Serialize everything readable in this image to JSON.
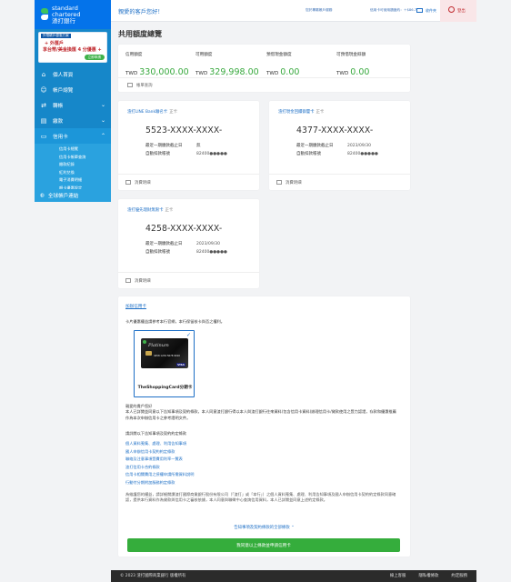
{
  "brand": {
    "line1": "standard",
    "line2": "chartered",
    "line3": "渣打銀行"
  },
  "promo": {
    "tag": "外幣帳戶優惠方案",
    "line1": "+ 外匯戶",
    "line2": "享台幣/美金換匯 4 分優惠 +",
    "button": "立即申請"
  },
  "nav": {
    "home": "個人首頁",
    "accounts": "帳戶總覽",
    "transfer": "轉帳",
    "payment": "繳款",
    "credit_card": "信用卡",
    "sub_items": [
      "信用卡總覽",
      "信用卡帳單查詢",
      "繳款紀錄",
      "紅利兌換",
      "電子消費明細",
      "額卡優惠設定"
    ],
    "global": "全球帳戶連結"
  },
  "topbar": {
    "greeting": "親愛的客戶您好！",
    "last_login": "您於專屬帳戶服務",
    "cc_balance": "信用卡可使用額度約：＋$86.7",
    "inbox": "收件夾",
    "logout": "登出"
  },
  "page_title": "共用額度總覽",
  "summary": {
    "credit_limit": {
      "label": "信用額度",
      "currency": "TWD",
      "value": "330,000.00"
    },
    "available": {
      "label": "可用額度",
      "currency": "TWD",
      "value": "329,998.00"
    },
    "cash_limit": {
      "label": "預借現金額度",
      "currency": "TWD",
      "value": "0.00"
    },
    "cash_available": {
      "label": "可預借現金餘額",
      "currency": "TWD",
      "value": "0.00"
    },
    "footer": "帳單查詢"
  },
  "cards": [
    {
      "name": "渣打LINE Bank聯名卡",
      "tag": "正卡",
      "number": "5523-XXXX-XXXX-",
      "due_label": "最近一期繳款截止日",
      "due_value": "無",
      "auto_label": "自動扣款帳號",
      "auto_value": "82400●●●●●",
      "footer": "消費明細"
    },
    {
      "name": "渣打現金回饋御璽卡",
      "tag": "正卡",
      "number": "4377-XXXX-XXXX-",
      "due_label": "最近一期繳款截止日",
      "due_value": "2023/09/30",
      "auto_label": "自動扣款帳號",
      "auto_value": "82400●●●●●",
      "footer": "消費明細"
    },
    {
      "name": "渣打優先理財無限卡",
      "tag": "正卡",
      "number": "4258-XXXX-XXXX-",
      "due_label": "最近一期繳款截止日",
      "due_value": "2023/09/30",
      "auto_label": "自動扣款帳號",
      "auto_value": "82400●●●●●",
      "footer": "消費明細"
    }
  ],
  "apply": {
    "title": "加辦信用卡",
    "intro": "卡片優惠權益請參考本行官網，本行保留核卡與否之權利。",
    "card_label": "TheShoppingCard分期卡",
    "card_visual": {
      "platinum": "Platinum",
      "number": "4258 1234 5678 9010",
      "visa": "VISA"
    },
    "p1": "親愛的貴戶您好\n本人已詳閱並同意以下告知事項及契約條款，本人同意渣打銀行得以本人與渣打銀行往來資料(包含信用卡資料)辦理信用卡/貸款使用之暨力認證，存款和優惠推薦作為本次申辦信用卡之參考證明文件。",
    "p2": "請詳閱以下告知事項及契約約定條款",
    "links": [
      "個人資料蒐集、處理、利用告知事項",
      "國人申辦信用卡契約約定條款",
      "聯絡及注意事項暨費用利率一覽表",
      "渣打信用卡合約條款",
      "信用卡相關費用之授權申請所需資料說明",
      "行動付分期附加服務約定條款"
    ],
    "p3": "為維護您的權益，請詳細閱讀渣打國際商業銀行股份有限公司（「渣打」或「本行」）之個人資料蒐集、處理、利用告知事項及國人申辦信用卡契約約定條款同意確認，提供本行資料作為貸款與信用卡之審核依據，本人同意與聯徵中心查詢信用資料，本人已詳閱並同意上述約定條款。",
    "expand": "告知事項及契約條款的全部條款",
    "button": "我同意以上條款並申請信用卡"
  },
  "footer": {
    "copyright": "© 2023 渣打國際商業銀行 版權所有",
    "links": [
      "線上客服",
      "隱私權條款",
      "約定服務"
    ]
  }
}
